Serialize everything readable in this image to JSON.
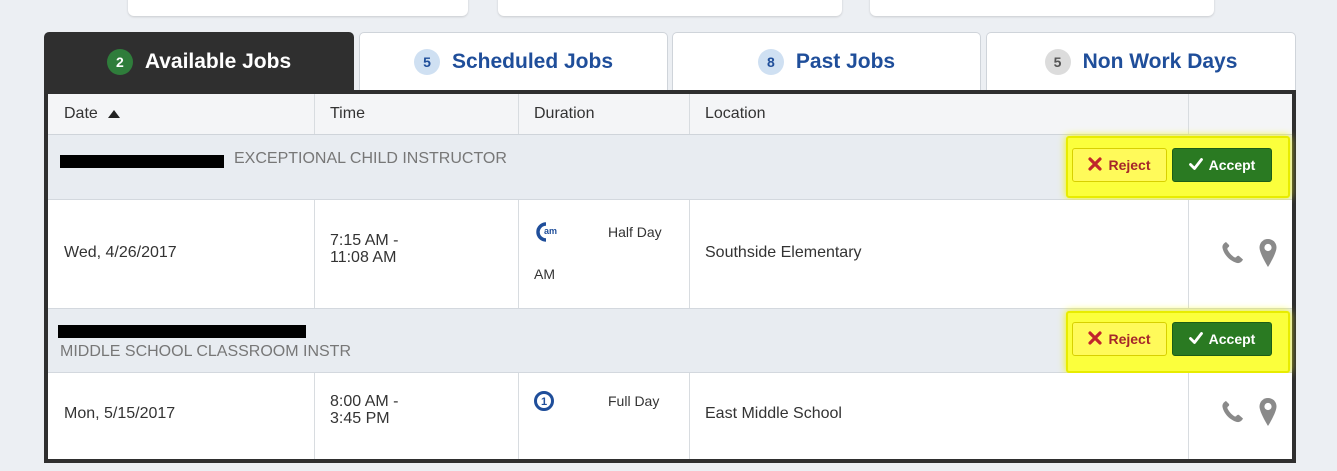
{
  "tabs": [
    {
      "count": "2",
      "label": "Available Jobs"
    },
    {
      "count": "5",
      "label": "Scheduled Jobs"
    },
    {
      "count": "8",
      "label": "Past Jobs"
    },
    {
      "count": "5",
      "label": "Non Work Days"
    }
  ],
  "table": {
    "headers": {
      "date": "Date",
      "time": "Time",
      "duration": "Duration",
      "location": "Location"
    },
    "sort_icon": "triangle-up-icon"
  },
  "jobs": [
    {
      "title": "EXCEPTIONAL CHILD INSTRUCTOR",
      "reject_label": "Reject",
      "accept_label": "Accept",
      "date": "Wed, 4/26/2017",
      "time_start": "7:15 AM -",
      "time_end": "11:08 AM",
      "duration_icon": "am-icon",
      "duration_icon_text": "am",
      "duration_label": "Half Day",
      "duration_sub": "AM",
      "location": "Southside Elementary"
    },
    {
      "title": "MIDDLE SCHOOL CLASSROOM INSTR",
      "reject_label": "Reject",
      "accept_label": "Accept",
      "date": "Mon, 5/15/2017",
      "time_start": "8:00 AM -",
      "time_end": "3:45 PM",
      "duration_icon": "full-day-icon",
      "duration_icon_text": "1",
      "duration_label": "Full Day",
      "location": "East Middle School"
    }
  ],
  "colors": {
    "accent_blue": "#1f4e9a",
    "accept_green": "#2a7a22",
    "reject_red": "#a5262a",
    "highlight": "#fbff3c"
  }
}
